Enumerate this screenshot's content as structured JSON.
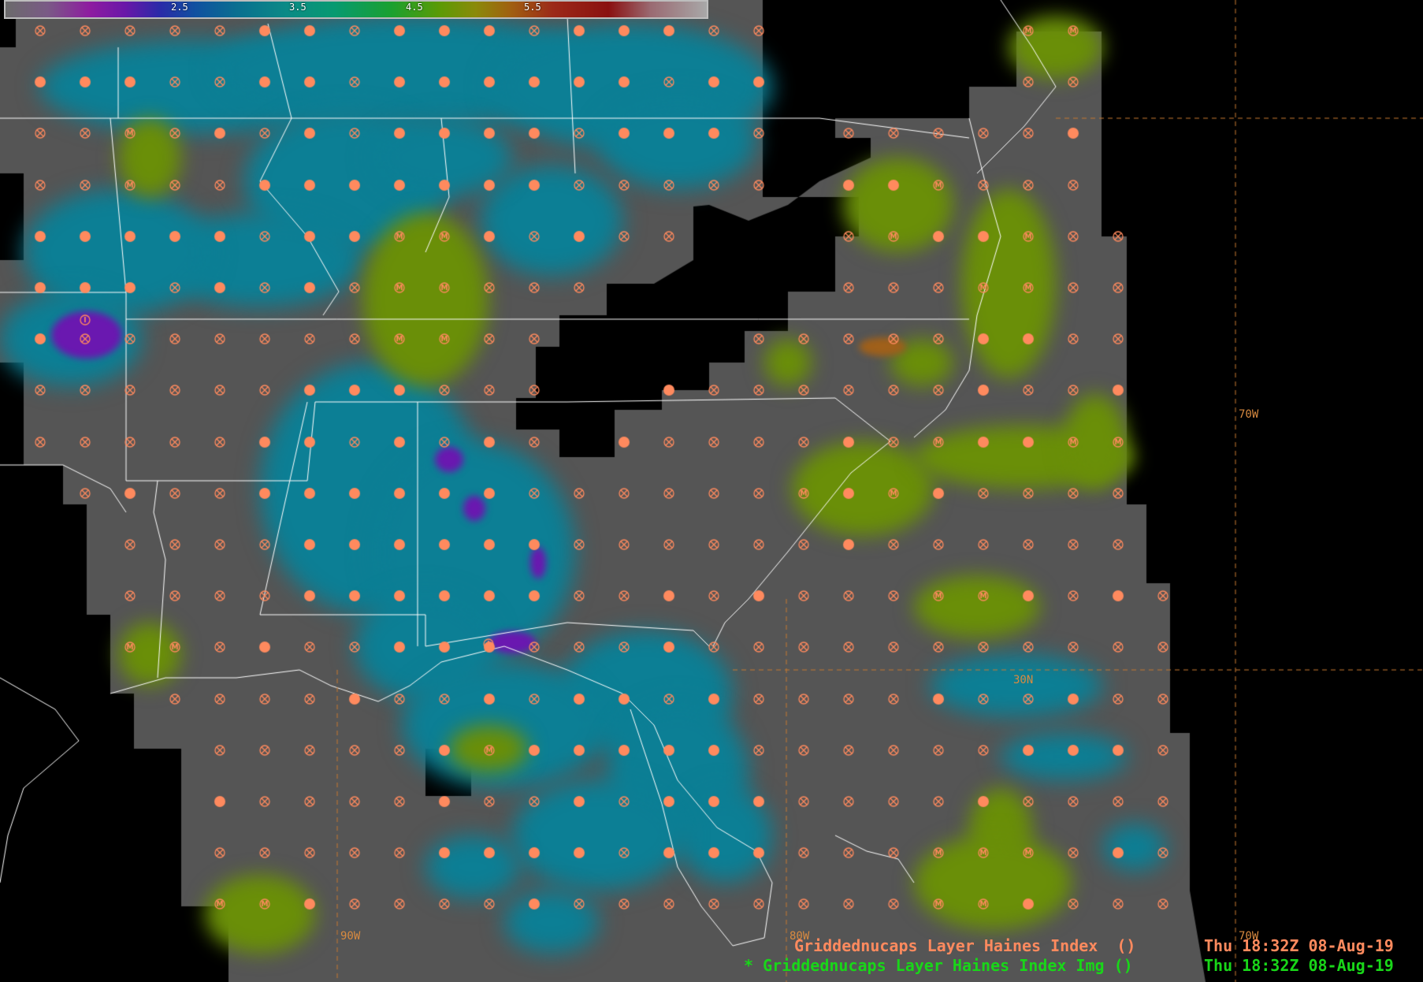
{
  "colorbar": {
    "ticks": [
      "2.5",
      "3.5",
      "4.5",
      "5.5"
    ]
  },
  "status_lines": [
    {
      "label": "Griddednucaps Layer Haines Index  ()",
      "time": "Thu 18:32Z 08-Aug-19",
      "color": "#ff8a5e"
    },
    {
      "label": "* Griddednucaps Layer Haines Index Img ()",
      "time": "Thu 18:32Z 08-Aug-19",
      "color": "#19d619"
    }
  ],
  "coordinate_labels": [
    "70W",
    "30N",
    "90W",
    "80W",
    "70W"
  ],
  "colors": {
    "background": "#000000",
    "grid_gray": "#555555",
    "cyan_teal": "#0c7f95",
    "green": "#6a8f08",
    "purple": "#6a18b0",
    "marker_orange": "#ff8a5e",
    "map_lines": "#ffffff"
  },
  "icon_names": [
    "filled-dot-marker-icon",
    "crossed-circle-marker-icon",
    "m-circle-marker-icon",
    "i-circle-marker-icon"
  ]
}
